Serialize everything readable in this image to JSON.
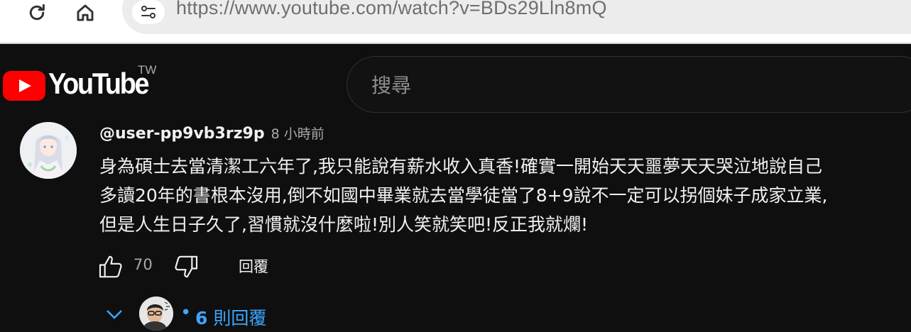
{
  "browser": {
    "url_host": "https://www.youtube.com",
    "url_path": "/watch?v=BDs29Lln8mQ",
    "icons": [
      "reload-icon",
      "home-icon",
      "site-info-icon"
    ]
  },
  "masthead": {
    "logo_text": "YouTube",
    "region": "TW",
    "search_placeholder": "搜尋"
  },
  "comment": {
    "author": "@user-pp9vb3rz9p",
    "time": "8 小時前",
    "lines": [
      "身為碩士去當清潔工六年了,我只能說有薪水收入真香!確實一開始天天噩夢天天哭泣地說自己",
      "多讀20年的書根本沒用,倒不如國中畢業就去當學徒當了8+9說不一定可以拐個妹子成家立業,",
      "但是人生日子久了,習慣就沒什麼啦!別人笑就笑吧!反正我就爛!"
    ],
    "likes": "70",
    "reply_label": "回覆",
    "replies_count": "6",
    "replies_suffix": "則回覆"
  },
  "colors": {
    "background": "#0f0f0f",
    "accent_blue": "#3ea6ff",
    "brand_red": "#ff0000"
  }
}
